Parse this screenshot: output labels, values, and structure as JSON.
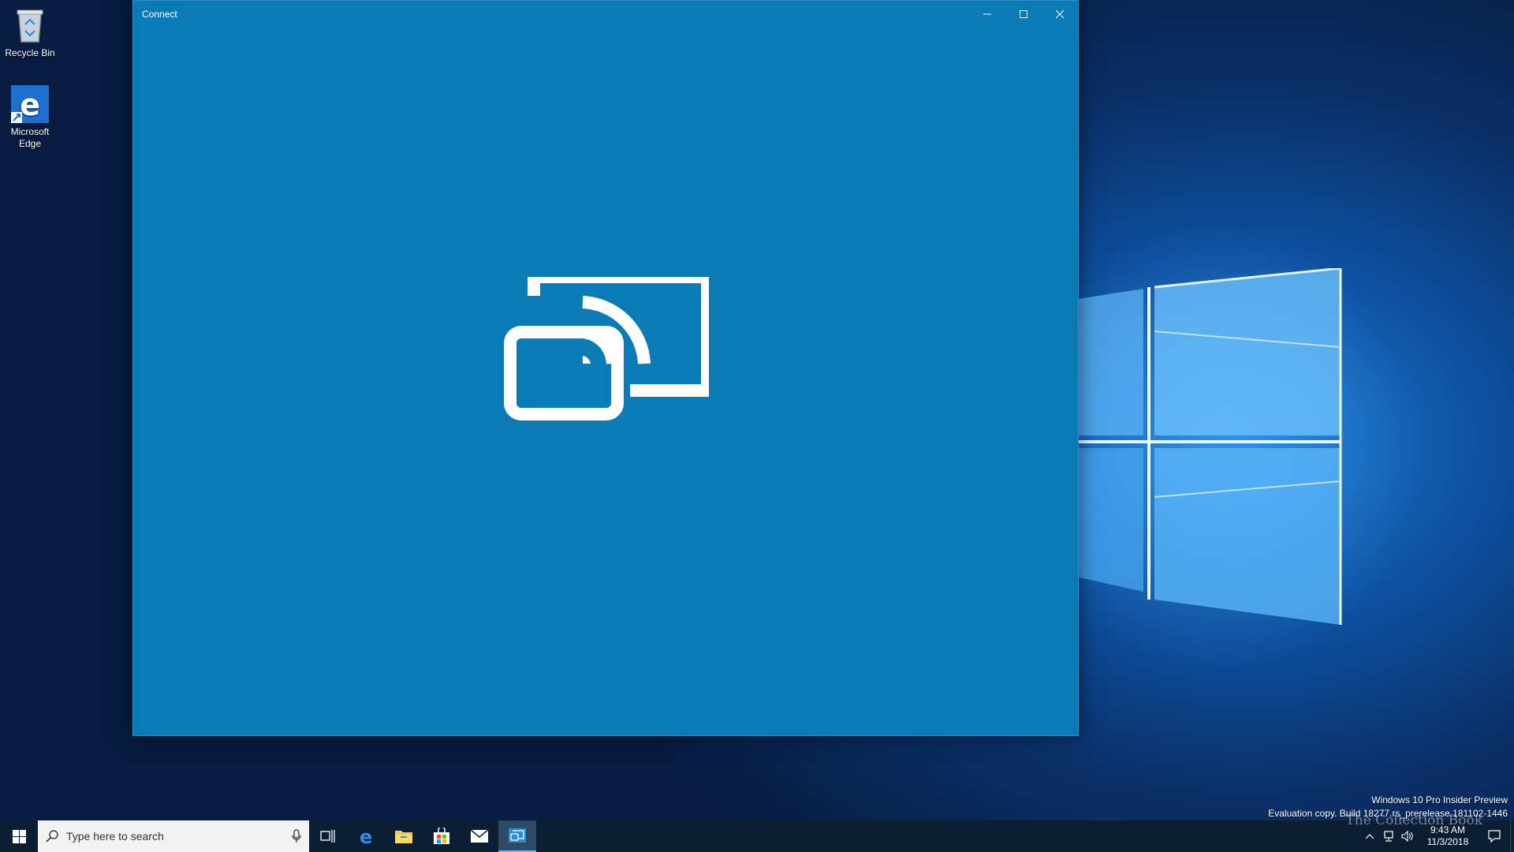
{
  "desktop": {
    "icons": [
      {
        "label": "Recycle Bin"
      },
      {
        "label": "Microsoft Edge"
      }
    ]
  },
  "window": {
    "title": "Connect",
    "minimize_label": "–",
    "accent_color": "#0a7bb4"
  },
  "watermark": {
    "line1": "Windows 10 Pro Insider Preview",
    "line2": "Evaluation copy. Build 18277.rs_prerelease.181102-1446"
  },
  "brand": {
    "text": "The Collection Book"
  },
  "taskbar": {
    "search_placeholder": "Type here to search",
    "apps": [
      {
        "name": "task-view"
      },
      {
        "name": "microsoft-edge"
      },
      {
        "name": "file-explorer"
      },
      {
        "name": "microsoft-store"
      },
      {
        "name": "mail"
      },
      {
        "name": "connect"
      }
    ],
    "clock": {
      "time": "9:43 AM",
      "date": "11/3/2018"
    }
  }
}
